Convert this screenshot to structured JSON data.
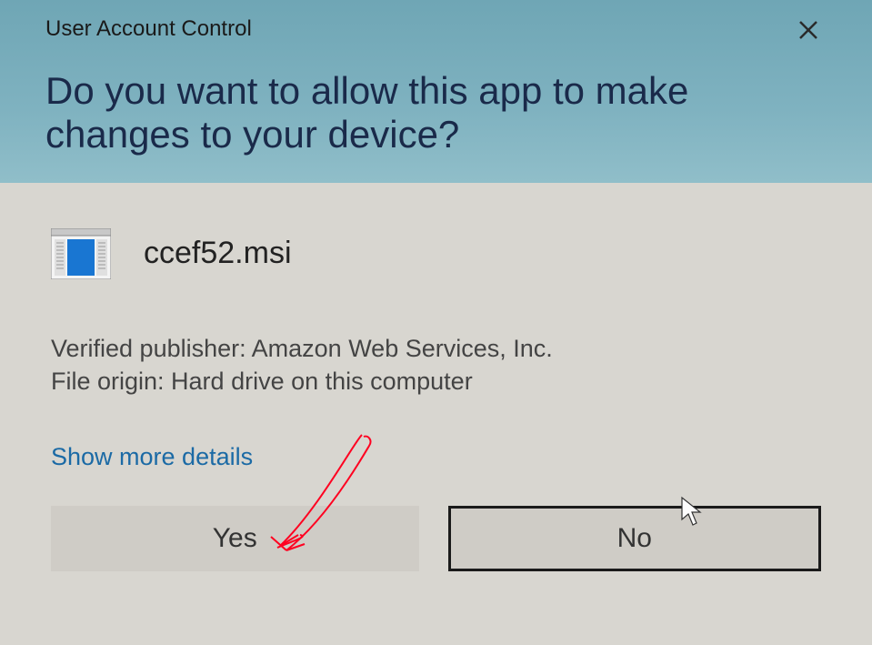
{
  "header": {
    "title": "User Account Control",
    "question": "Do you want to allow this app to make changes to your device?"
  },
  "app": {
    "name": "ccef52.msi",
    "publisher_label": "Verified publisher: ",
    "publisher_value": "Amazon Web Services, Inc.",
    "origin_label": "File origin: ",
    "origin_value": "Hard drive on this computer"
  },
  "links": {
    "show_more": "Show more details"
  },
  "buttons": {
    "yes": "Yes",
    "no": "No"
  }
}
